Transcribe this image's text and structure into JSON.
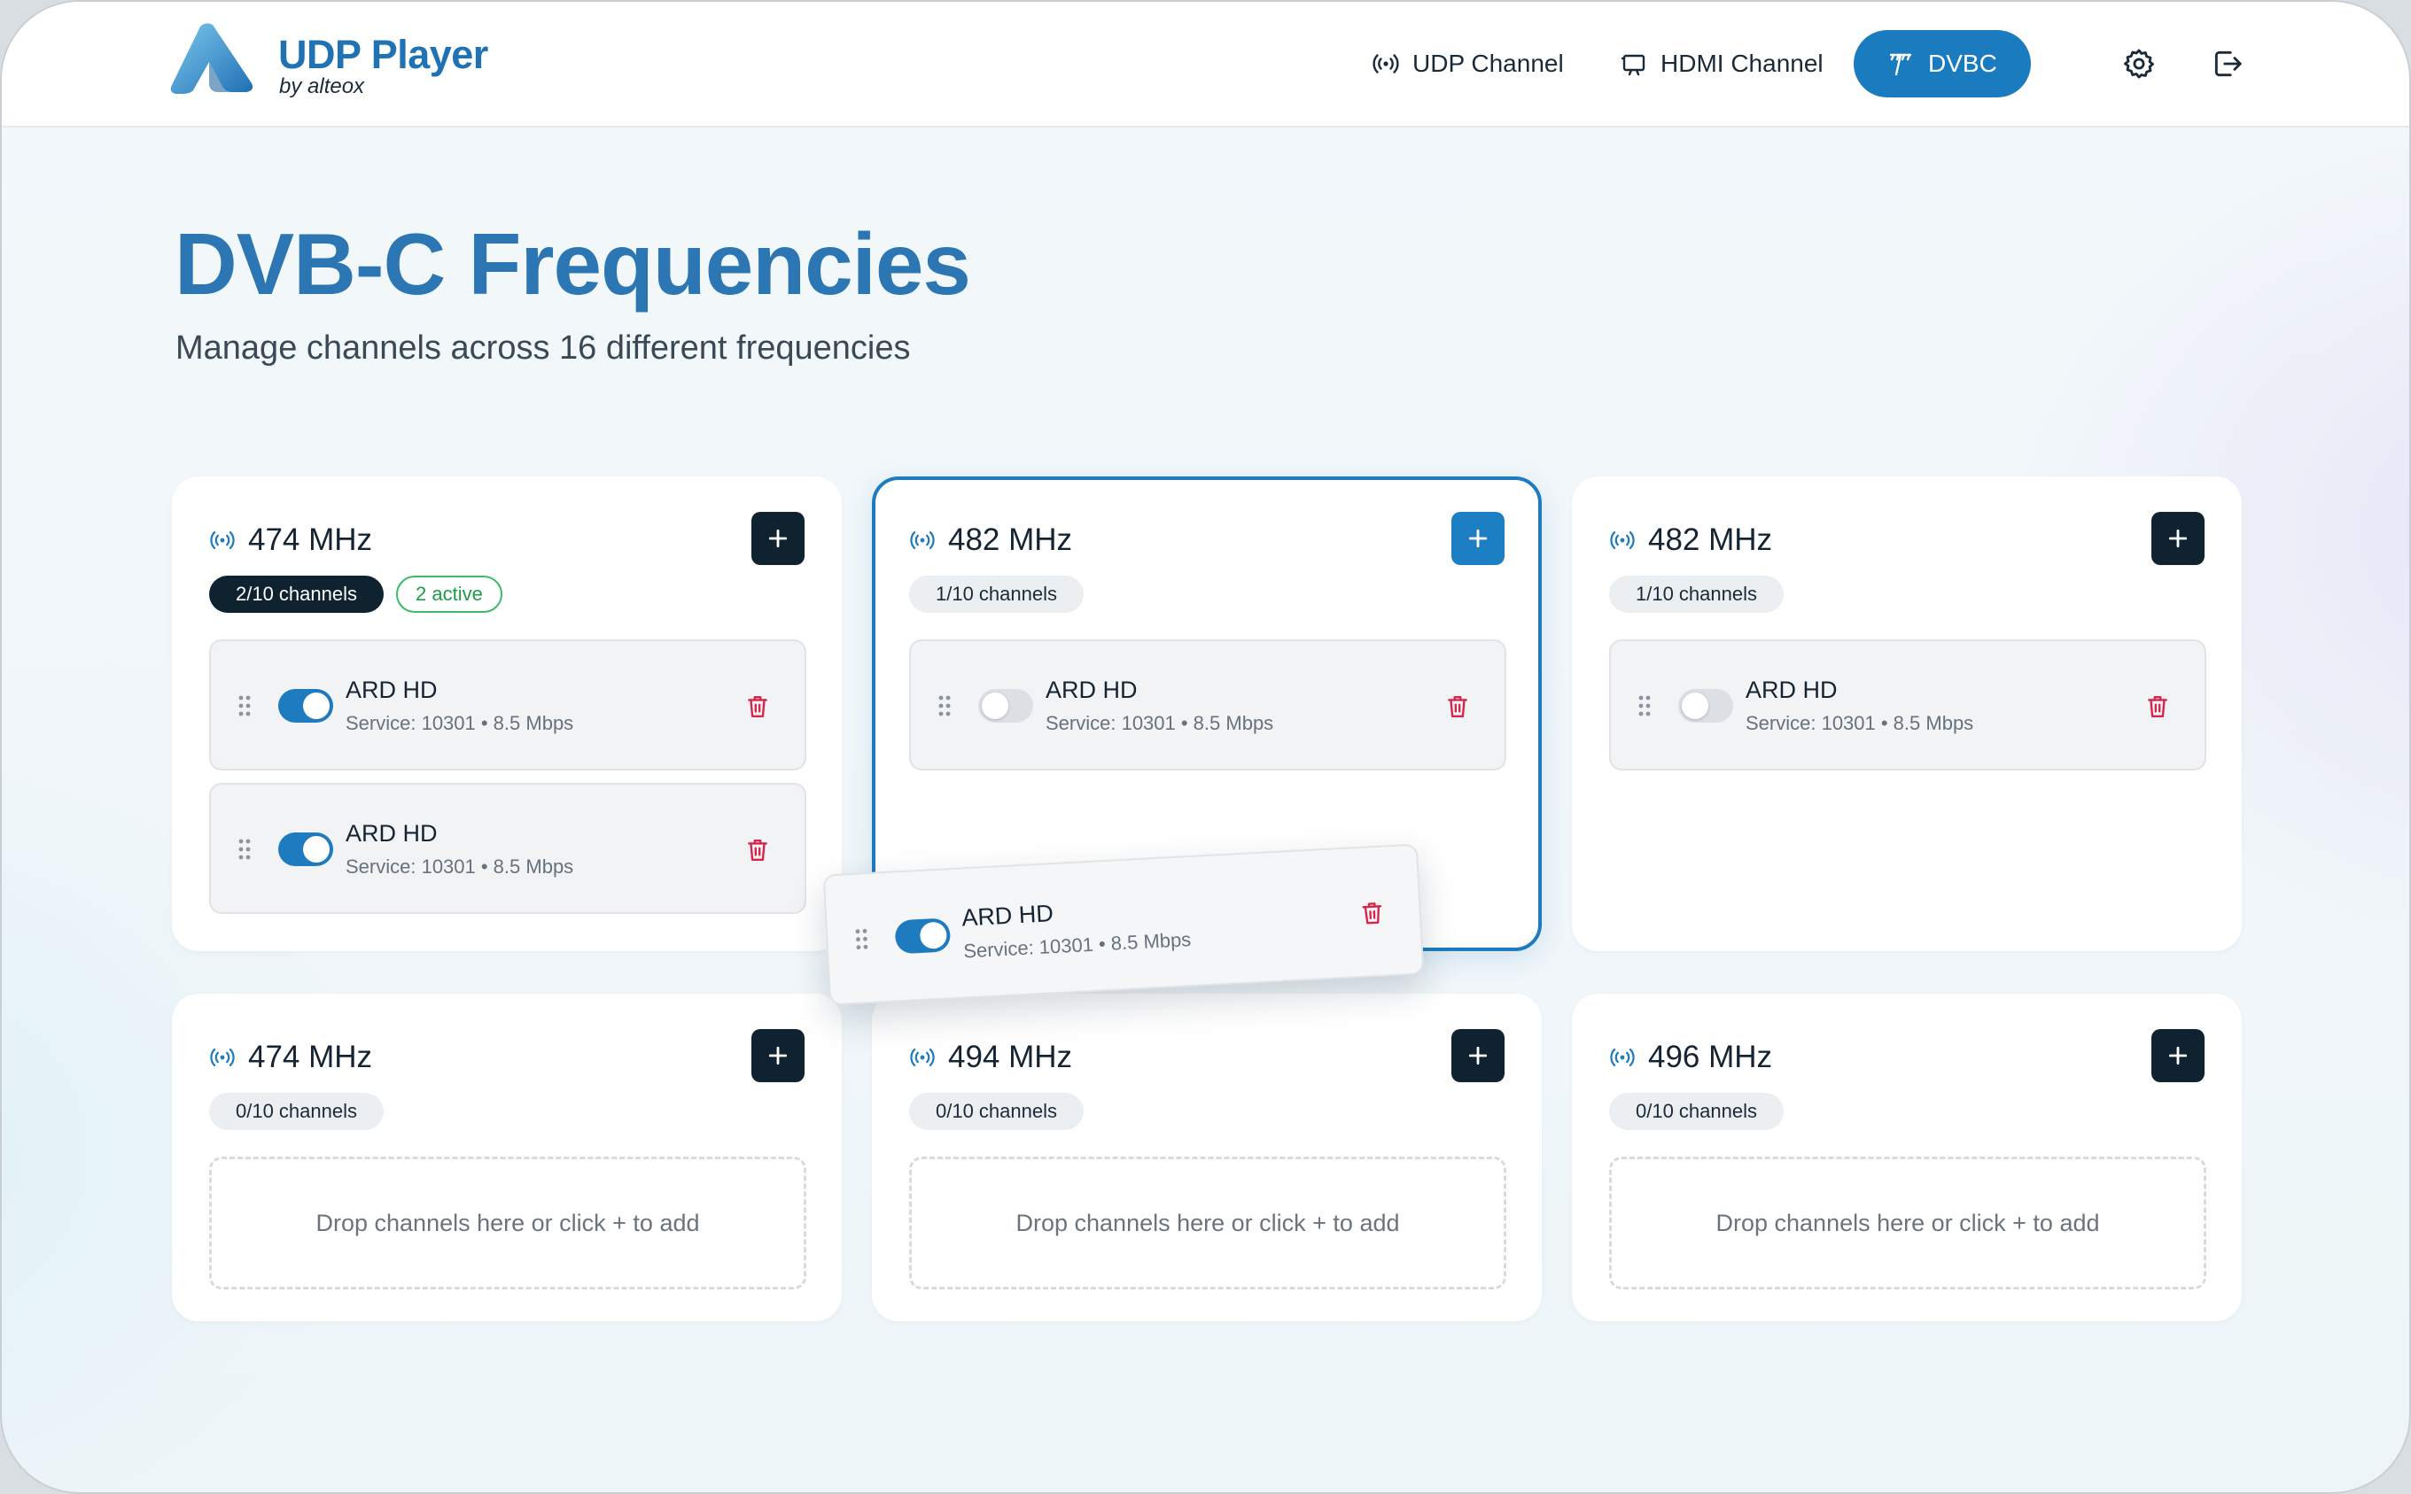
{
  "app": {
    "title": "UDP Player",
    "subtitle": "by alteox"
  },
  "nav": {
    "udp_label": "UDP Channel",
    "hdmi_label": "HDMI Channel",
    "dvbc_label": "DVBC",
    "active": "DVBC"
  },
  "page": {
    "title": "DVB-C Frequencies",
    "subtitle": "Manage channels across 16 different frequencies"
  },
  "colors": {
    "accent": "#1e7bbf",
    "dark": "#0f2230",
    "active_green": "#1e9b4a",
    "delete_red": "#d8244a"
  },
  "cards": [
    {
      "frequency": "474 MHz",
      "count": "2/10 channels",
      "active": "2 active",
      "channels": [
        {
          "name": "ARD HD",
          "meta": "Service: 10301 • 8.5 Mbps",
          "enabled": true
        },
        {
          "name": "ARD HD",
          "meta": "Service: 10301 • 8.5 Mbps",
          "enabled": true
        }
      ]
    },
    {
      "frequency": "482 MHz",
      "count": "1/10 channels",
      "highlighted": true,
      "channels": [
        {
          "name": "ARD HD",
          "meta": "Service: 10301 • 8.5 Mbps",
          "enabled": false
        }
      ]
    },
    {
      "frequency": "482 MHz",
      "count": "1/10 channels",
      "channels": [
        {
          "name": "ARD HD",
          "meta": "Service: 10301 • 8.5 Mbps",
          "enabled": false
        }
      ]
    },
    {
      "frequency": "474 MHz",
      "count": "0/10 channels",
      "empty_text": "Drop channels here or click + to add"
    },
    {
      "frequency": "494 MHz",
      "count": "0/10 channels",
      "empty_text": "Drop channels here or click + to add"
    },
    {
      "frequency": "496 MHz",
      "count": "0/10 channels",
      "empty_text": "Drop channels here or click + to add"
    }
  ],
  "dragging": {
    "name": "ARD HD",
    "meta": "Service: 10301 • 8.5 Mbps",
    "enabled": true
  }
}
